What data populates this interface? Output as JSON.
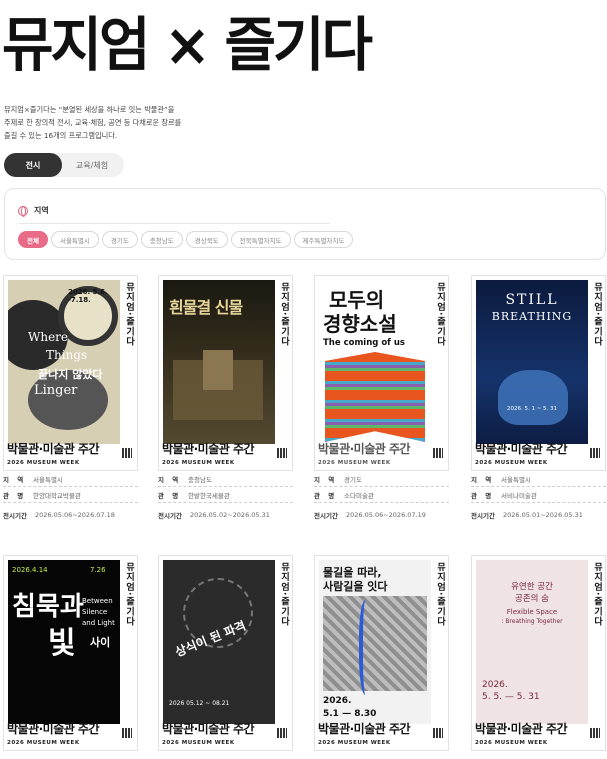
{
  "hero": {
    "title": "뮤지엄 × 즐기다"
  },
  "intro": {
    "line1": "뮤지엄×즐기다는 “분열된 세상을 하나로 잇는 박물관”을",
    "line2": "주제로 한 창의적 전시, 교육·체험, 공연 등 다채로운 장르를",
    "line3": "즐길 수 있는 16개의 프로그램입니다."
  },
  "tabs": [
    {
      "label": "전시"
    },
    {
      "label": "교육/체험"
    }
  ],
  "filter": {
    "label": "지역",
    "icon": "globe-icon",
    "accent": "#e86b87",
    "chips": [
      "전체",
      "서울특별시",
      "경기도",
      "충청남도",
      "경상북도",
      "전북특별자치도",
      "제주특별자치도"
    ]
  },
  "poster_common": {
    "side_text": "뮤지엄·즐기다",
    "bottom_title": "박물관·미술관 주간",
    "bottom_sub": "2026 MUSEUM WEEK"
  },
  "info_labels": {
    "region": "지 역",
    "venue": "관 명",
    "period": "전시기간"
  },
  "cards": [
    {
      "poster_lines": [
        "2026. 5.6. -7.18.",
        "Where",
        "Things",
        "Linger",
        "끝나지 않았다"
      ],
      "region": "서울특별시",
      "venue": "한양대학교박물관",
      "period": "2026.05.06~2026.07.18"
    },
    {
      "poster_lines": [
        "흰물결 신물"
      ],
      "region": "충청남도",
      "venue": "한밭한국세물관",
      "period": "2026.05.02~2026.05.31"
    },
    {
      "poster_lines": [
        "모두의",
        "경향소설",
        "The coming of us"
      ],
      "region": "경기도",
      "venue": "소다미술관",
      "period": "2026.05.06~2026.07.19"
    },
    {
      "poster_lines": [
        "STILL",
        "BREATHING",
        "2026. 5. 1 ~ 5. 31"
      ],
      "region": "서울특별시",
      "venue": "서비나미술관",
      "period": "2026.05.01~2026.05.31"
    },
    {
      "poster_lines": [
        "2026.4.14",
        "7.26",
        "침묵과",
        "빛",
        "Between Silence and Light",
        "사이"
      ],
      "region": "",
      "venue": "",
      "period": ""
    },
    {
      "poster_lines": [
        "상식이 된 파격",
        "2026 05.12 ~ 08.21"
      ],
      "region": "",
      "venue": "",
      "period": ""
    },
    {
      "poster_lines": [
        "물길을 따라,",
        "사람길을 잇다",
        "2026.",
        "5.1 — 8.30"
      ],
      "region": "",
      "venue": "",
      "period": ""
    },
    {
      "poster_lines": [
        "유연한 공간",
        "공존의 숨",
        "Flexible Space",
        ": Breathing Together",
        "2026.",
        "5. 5. — 5. 31"
      ],
      "region": "",
      "venue": "",
      "period": ""
    }
  ]
}
